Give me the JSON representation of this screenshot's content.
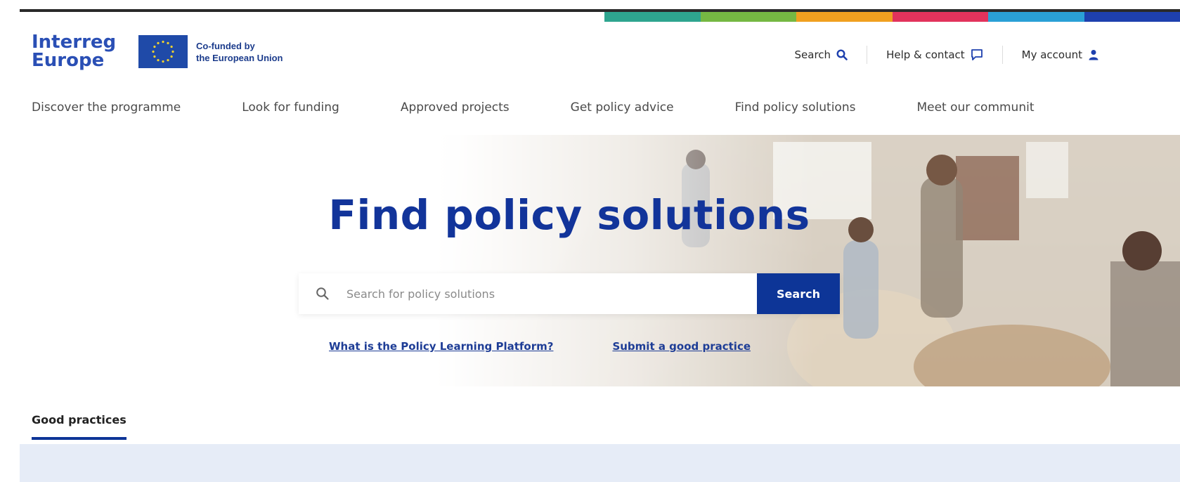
{
  "brand": {
    "logo_line1": "Interreg",
    "logo_line2": "Europe",
    "cofunded_line1": "Co-funded by",
    "cofunded_line2": "the European Union",
    "accent_color": "#12349a",
    "strip_colors": [
      "#2ea58f",
      "#75b843",
      "#f0a020",
      "#e2335c",
      "#2aa0d6",
      "#1e40ae"
    ]
  },
  "utility_nav": [
    {
      "label": "Search",
      "icon": "search-icon"
    },
    {
      "label": "Help & contact",
      "icon": "chat-icon"
    },
    {
      "label": "My account",
      "icon": "user-icon"
    }
  ],
  "main_nav": [
    {
      "label": "Discover the programme"
    },
    {
      "label": "Look for funding"
    },
    {
      "label": "Approved projects"
    },
    {
      "label": "Get policy advice"
    },
    {
      "label": "Find policy solutions"
    },
    {
      "label": "Meet our communit"
    }
  ],
  "hero": {
    "title": "Find policy solutions",
    "search_placeholder": "Search for policy solutions",
    "search_button": "Search",
    "links": [
      {
        "label": "What is the Policy Learning Platform?"
      },
      {
        "label": "Submit a good practice"
      }
    ]
  },
  "tabs": {
    "active": "Good practices"
  }
}
